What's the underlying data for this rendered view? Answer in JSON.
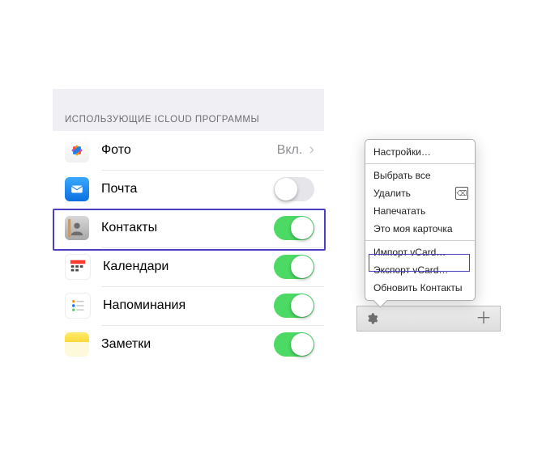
{
  "ios": {
    "section_header": "ИСПОЛЬЗУЮЩИЕ ICLOUD ПРОГРАММЫ",
    "rows": {
      "photos": {
        "label": "Фото",
        "value": "Вкл.",
        "toggle": null
      },
      "mail": {
        "label": "Почта",
        "toggle": false
      },
      "contacts": {
        "label": "Контакты",
        "toggle": true
      },
      "calendar": {
        "label": "Календари",
        "toggle": true
      },
      "reminders": {
        "label": "Напоминания",
        "toggle": true
      },
      "notes": {
        "label": "Заметки",
        "toggle": true
      }
    }
  },
  "dropdown": {
    "items": {
      "settings": "Настройки…",
      "select_all": "Выбрать все",
      "delete": "Удалить",
      "print": "Напечатать",
      "mycard": "Это моя карточка",
      "import": "Импорт vCard…",
      "export": "Экспорт vCard…",
      "refresh": "Обновить Контакты"
    }
  },
  "highlight": {
    "ios_row": "contacts",
    "menu_item": "export"
  },
  "colors": {
    "highlight": "#4a3fc4",
    "toggle_on": "#4cd964"
  }
}
